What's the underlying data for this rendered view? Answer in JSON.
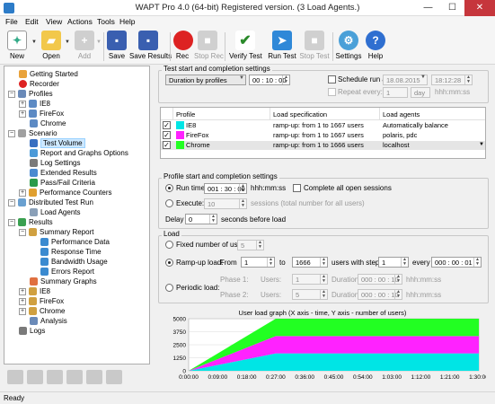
{
  "window": {
    "title": "WAPT Pro 4.0 (64-bit) Registered version. (3 Load Agents.)",
    "minimize": "—",
    "maximize": "☐",
    "close": "✕"
  },
  "menu": [
    "File",
    "Edit",
    "View",
    "Actions",
    "Tools",
    "Help"
  ],
  "toolbar": {
    "new": "New",
    "open": "Open",
    "add": "Add",
    "save": "Save",
    "save_results": "Save Results",
    "rec": "Rec",
    "stop_rec": "Stop Rec",
    "verify": "Verify Test",
    "run": "Run Test",
    "stop": "Stop Test",
    "settings": "Settings",
    "help": "Help"
  },
  "tree": {
    "getting_started": "Getting Started",
    "recorder": "Recorder",
    "profiles": "Profiles",
    "ie8": "IE8",
    "firefox": "FireFox",
    "chrome": "Chrome",
    "scenario": "Scenario",
    "test_volume": "Test Volume",
    "report_options": "Report and Graphs Options",
    "log_settings": "Log Settings",
    "extended_results": "Extended Results",
    "pass_fail": "Pass/Fail Criteria",
    "perf_counters": "Performance Counters",
    "distributed": "Distributed Test Run",
    "load_agents": "Load Agents",
    "results": "Results",
    "summary_report": "Summary Report",
    "performance_data": "Performance Data",
    "response_time": "Response Time",
    "bandwidth": "Bandwidth Usage",
    "errors": "Errors Report",
    "summary_graphs": "Summary Graphs",
    "r_ie8": "IE8",
    "r_firefox": "FireFox",
    "r_chrome": "Chrome",
    "analysis": "Analysis",
    "logs": "Logs"
  },
  "start": {
    "group_label": "Test start and completion settings",
    "mode": "Duration by profiles",
    "duration": "00 : 10 : 00",
    "schedule_label": "Schedule run at:",
    "schedule_date": "18.08.2015",
    "schedule_time": "18:12:28",
    "repeat_label": "Repeat every:",
    "repeat_value": "1",
    "repeat_unit": "day",
    "repeat_fmt": "hhh:mm:ss"
  },
  "profiles_table": {
    "headers": [
      "Profile",
      "Load specification",
      "Load agents"
    ],
    "rows": [
      {
        "name": "IE8",
        "spec": "ramp-up: from 1 to 1667 users",
        "agents": "Automatically balance",
        "color": "#00e5e5"
      },
      {
        "name": "FireFox",
        "spec": "ramp-up: from 1 to 1667 users",
        "agents": "polaris, pdc",
        "color": "#ff22ff"
      },
      {
        "name": "Chrome",
        "spec": "ramp-up: from 1 to 1666 users",
        "agents": "localhost",
        "color": "#22ff22"
      }
    ]
  },
  "profile_settings": {
    "group_label": "Profile start and completion settings",
    "run_time_label": "Run time:",
    "run_time": "001 : 30 : 00",
    "time_fmt": "hhh:mm:ss",
    "complete_label": "Complete all open sessions",
    "execute_label": "Execute:",
    "execute_value": "10",
    "execute_suffix": "sessions (total number for all users)",
    "delay_label": "Delay",
    "delay_value": "0",
    "delay_suffix": "seconds before load"
  },
  "load": {
    "group_label": "Load",
    "fixed_label": "Fixed number of users:",
    "fixed_value": "5",
    "ramp_label": "Ramp-up load:",
    "from_label": "From",
    "from_value": "1",
    "to_label": "to",
    "to_value": "1666",
    "step_label": "users with step",
    "step_value": "1",
    "every_label": "every",
    "every_value": "000 : 00 : 01",
    "periodic_label": "Periodic load:",
    "phase1": "Phase 1:",
    "phase2": "Phase 2:",
    "users_label": "Users:",
    "p1_users": "1",
    "p2_users": "5",
    "duration_label": "Duration:",
    "p1_duration": "000 : 00 : 10",
    "p2_duration": "000 : 00 : 10",
    "fmt": "hhh:mm:ss"
  },
  "status": "Ready",
  "chart_data": {
    "type": "area",
    "title": "User load graph (X axis - time, Y axis - number of users)",
    "x": [
      "0:00:00",
      "0:09:00",
      "0:18:00",
      "0:27:00",
      "0:36:00",
      "0:45:00",
      "0:54:00",
      "1:03:00",
      "1:12:00",
      "1:21:00",
      "1:30:00"
    ],
    "x_minutes": [
      0,
      27,
      90
    ],
    "ylim": [
      0,
      5000
    ],
    "yticks": [
      0,
      1250,
      2500,
      3750,
      5000
    ],
    "series": [
      {
        "name": "IE8",
        "color": "#00e5e5",
        "values": [
          0,
          1667,
          1667
        ]
      },
      {
        "name": "FireFox",
        "color": "#ff22ff",
        "values": [
          0,
          1667,
          1667
        ]
      },
      {
        "name": "Chrome",
        "color": "#22ff22",
        "values": [
          0,
          1666,
          1666
        ]
      }
    ]
  }
}
